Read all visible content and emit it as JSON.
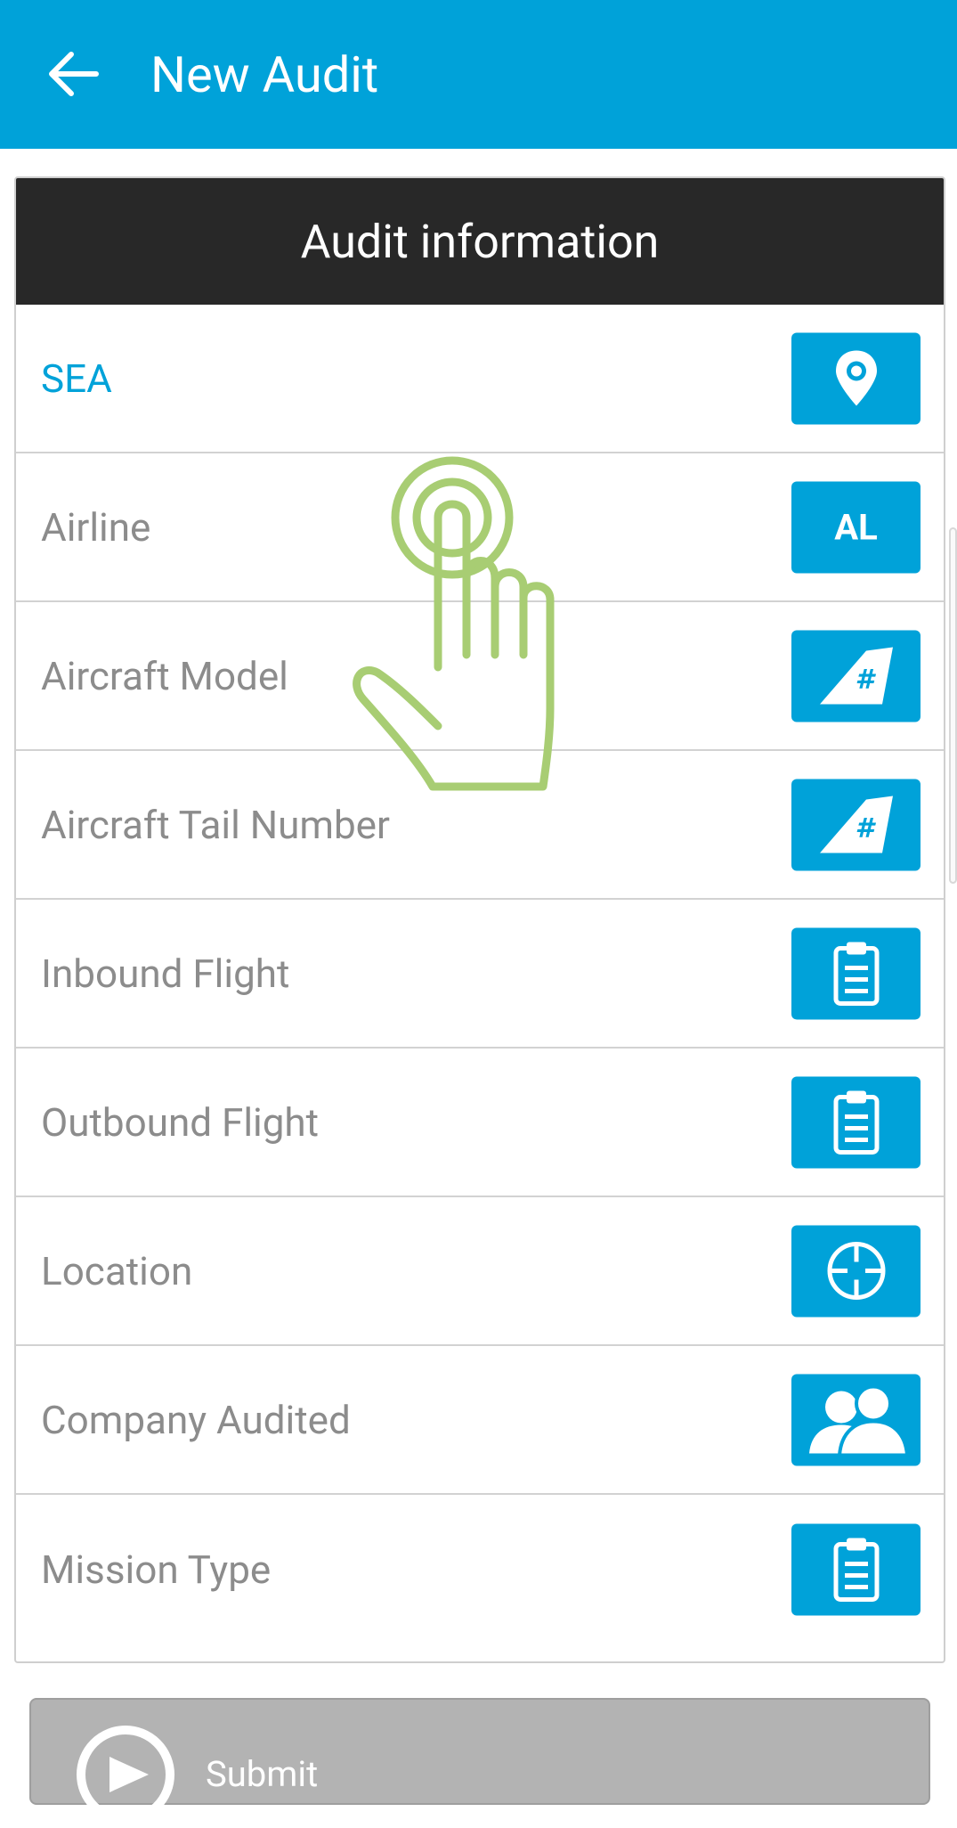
{
  "appbar": {
    "title": "New Audit"
  },
  "card": {
    "header": "Audit information",
    "rows": [
      {
        "label": "SEA",
        "icon": "map-pin-icon",
        "active": true
      },
      {
        "label": "Airline",
        "icon": "airline-al-icon",
        "button_text": "AL"
      },
      {
        "label": "Aircraft Model",
        "icon": "aircraft-tail-icon"
      },
      {
        "label": "Aircraft Tail Number",
        "icon": "aircraft-tail-icon"
      },
      {
        "label": "Inbound Flight",
        "icon": "clipboard-icon"
      },
      {
        "label": "Outbound Flight",
        "icon": "clipboard-icon"
      },
      {
        "label": "Location",
        "icon": "crosshair-icon"
      },
      {
        "label": "Company Audited",
        "icon": "users-icon"
      },
      {
        "label": "Mission Type",
        "icon": "clipboard-icon"
      }
    ]
  },
  "submit": {
    "label": "Submit"
  },
  "colors": {
    "primary": "#00a2d9",
    "header_bg": "#282828",
    "label_gray": "#8c8c8c",
    "hand_overlay": "#a8cd73"
  }
}
